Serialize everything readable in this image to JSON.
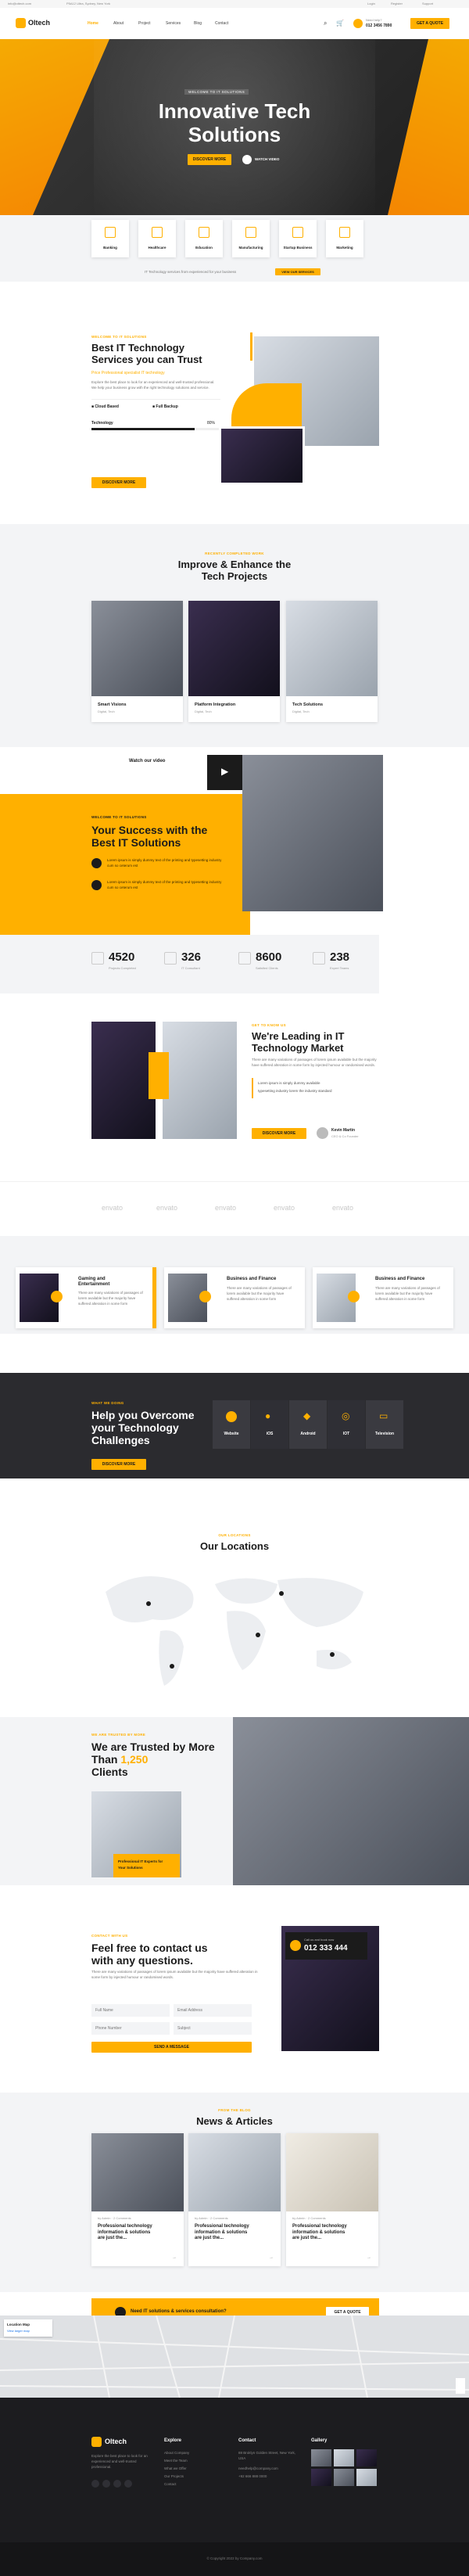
{
  "topbar": {
    "email": "info@ottech.com",
    "address": "P5A12 Ultra, Sydney, New York",
    "links": [
      "Login",
      "Register",
      "Support"
    ]
  },
  "nav": {
    "logo": "Oltech",
    "items": [
      "Home",
      "About",
      "Project",
      "Services",
      "Blog",
      "Contact"
    ],
    "phone_label": "Need help?",
    "phone": "012 3456 7890",
    "cta": "GET A QUOTE"
  },
  "hero": {
    "tag": "WELCOME TO IT SOLUTIONS",
    "title_line1": "Innovative Tech",
    "title_line2": "Solutions",
    "button": "DISCOVER MORE",
    "video_label": "WATCH VIDEO"
  },
  "services_bar": {
    "items": [
      "Banking",
      "Healthcare",
      "Education",
      "Manufacturing",
      "Startup Business",
      "Marketing"
    ],
    "note": "IT Technology services from experienced for your business",
    "note_button": "VIEW OUR SERVICES"
  },
  "about": {
    "tag": "WELCOME TO IT SOLUTIONS",
    "title_line1": "Best IT Technology",
    "title_line2": "Services you can Trust",
    "subtitle": "Price Professional specialist IT technology",
    "text": "Explore the best place to look for an experienced and well-trusted professional. We help your business grow with the right technology solutions and service.",
    "feature1": "Cloud Based",
    "feature2": "Full Backup",
    "progress_label": "Technology",
    "progress_value": "80%",
    "progress": 0.8,
    "button": "DISCOVER MORE"
  },
  "projects": {
    "tag": "RECENTLY COMPLETED WORK",
    "title_line1": "Improve & Enhance the",
    "title_line2": "Tech Projects",
    "items": [
      {
        "name": "Smart Visions",
        "category": "Digital, Tech"
      },
      {
        "name": "Platform Integration",
        "category": "Digital, Tech"
      },
      {
        "name": "Tech Solutions",
        "category": "Digital, Tech"
      }
    ]
  },
  "video": {
    "label": "Watch our video"
  },
  "success": {
    "tag": "WELCOME TO IT SOLUTIONS",
    "title_line1": "Your Success with the",
    "title_line2": "Best IT Solutions",
    "points": [
      "Lorem ipsum is simply dummy text of the printing and typesetting industry cum so ceterum est",
      "Lorem ipsum is simply dummy text of the printing and typesetting industry cum so ceterum est"
    ]
  },
  "stats": [
    {
      "value": "4520",
      "label": "Projects Completed"
    },
    {
      "value": "326",
      "label": "IT Consultant"
    },
    {
      "value": "8600",
      "label": "Satisfied Clients"
    },
    {
      "value": "238",
      "label": "Expert Teams"
    }
  ],
  "leading": {
    "tag": "GET TO KNOW US",
    "title_line1": "We're Leading in IT",
    "title_line2": "Technology Market",
    "text": "There are many variations of passages of lorem ipsum available but the majority have suffered alteration in some form by injected humour or randomised words.",
    "point1": "Lorem ipsum is simply dummy available",
    "point2": "typesetting industry lorem the industry standard",
    "button": "DISCOVER MORE",
    "author_name": "Kevin Martin",
    "author_role": "CEO & Co Founder"
  },
  "brands": [
    "envato",
    "envato",
    "envato",
    "envato",
    "envato"
  ],
  "feature_cards": [
    {
      "title_line1": "Gaming and",
      "title_line2": "Entertainment",
      "text": "There are many variations of passages of lorem available but the majority have suffered alteration in some form"
    },
    {
      "title_line1": "Business and Finance",
      "title_line2": "",
      "text": "There are many variations of passages of lorem available but the majority have suffered alteration in some form"
    },
    {
      "title_line1": "Business and Finance",
      "title_line2": "",
      "text": "There are many variations of passages of lorem available but the majority have suffered alteration in some form"
    }
  ],
  "challenges": {
    "tag": "WHAT WE DOING",
    "title_line1": "Help you Overcome",
    "title_line2": "your Technology",
    "title_line3": "Challenges",
    "button": "DISCOVER MORE",
    "items": [
      "Website",
      "iOS",
      "Android",
      "IOT",
      "Television"
    ]
  },
  "locations": {
    "tag": "OUR LOCATIONS",
    "title": "Our Locations"
  },
  "trusted": {
    "tag": "WE ARE TRUSTED BY MORE",
    "title_line1": "We are Trusted by More",
    "title_line2a": "Than",
    "title_number": "1,250",
    "title_line3": "Clients",
    "badge_line1": "Professional IT Experts for",
    "badge_line2": "Your Solutions"
  },
  "contact": {
    "tag": "CONTACT WITH US",
    "title_line1": "Feel free to contact us",
    "title_line2": "with any questions.",
    "text": "There are many variations of passages of lorem ipsum available but the majority have suffered alteration in some form by injected humour or randomised words.",
    "name_placeholder": "Full Name",
    "email_placeholder": "Email Address",
    "phone_placeholder": "Phone Number",
    "subject_placeholder": "Subject",
    "button": "SEND A MESSAGE",
    "call_label": "Call us and book now",
    "call_number": "012 333 444"
  },
  "news": {
    "tag": "FROM THE BLOG",
    "title": "News & Articles",
    "items": [
      {
        "meta": "by Admin · 2 Comments",
        "title_line1": "Professional technology",
        "title_line2": "information & solutions",
        "title_line3": "are just the..."
      },
      {
        "meta": "by Admin · 2 Comments",
        "title_line1": "Professional technology",
        "title_line2": "information & solutions",
        "title_line3": "are just the..."
      },
      {
        "meta": "by Admin · 2 Comments",
        "title_line1": "Professional technology",
        "title_line2": "information & solutions",
        "title_line3": "are just the..."
      }
    ]
  },
  "cta_bar": {
    "text": "Need IT solutions & services consultation?",
    "button": "GET A QUOTE"
  },
  "map_card": {
    "title": "Location Map",
    "text": "View larger map"
  },
  "footer": {
    "logo": "Oltech",
    "about": "Explore the best place to look for an experienced and well-trusted professional.",
    "col_explore": "Explore",
    "explore_items": [
      "About Company",
      "Meet the Team",
      "What we Offer",
      "Our Projects",
      "Contact"
    ],
    "col_contact": "Contact",
    "contact_address": "88 Broklyn Golden Street, New York, USA",
    "contact_email": "needhelp@company.com",
    "contact_phone": "+92 666 888 0000",
    "col_gallery": "Gallery",
    "copyright": "© Copyright 2022 by Company.com"
  }
}
